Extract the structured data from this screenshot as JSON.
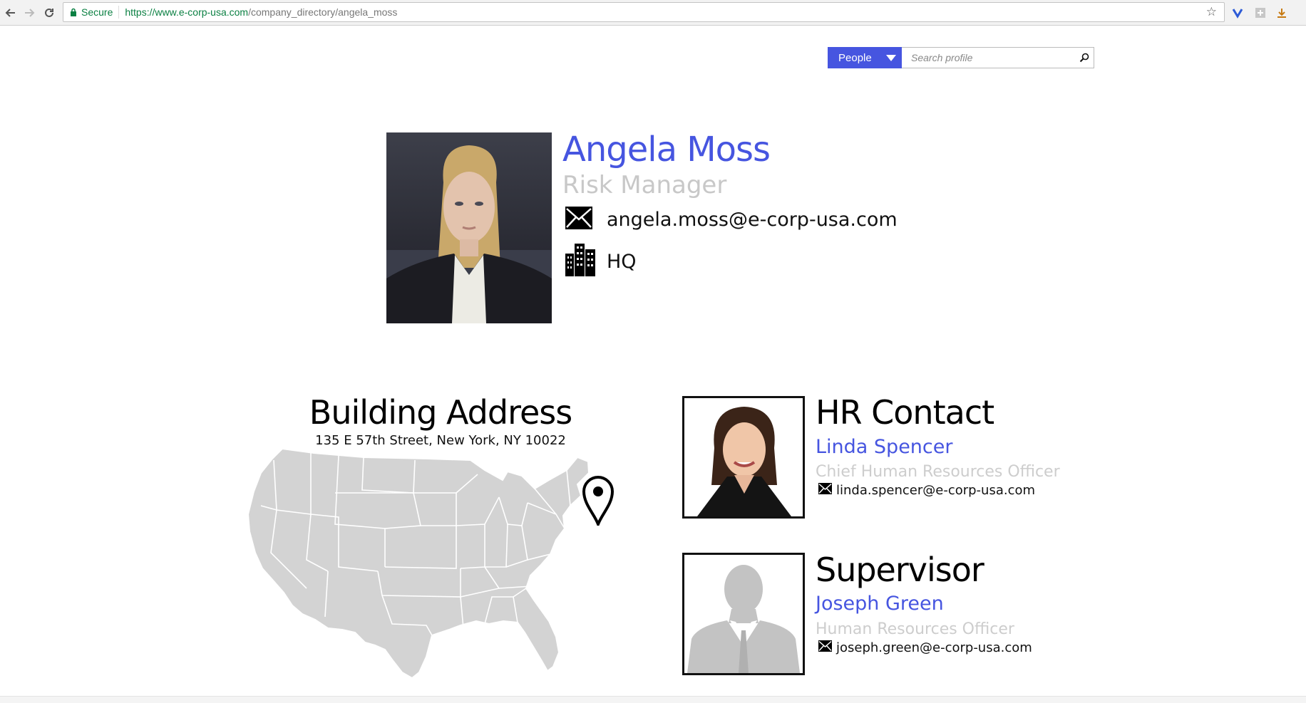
{
  "browser": {
    "secure_label": "Secure",
    "url_host": "https://www.e-corp-usa.com",
    "url_path": "/company_directory/angela_moss",
    "icons": [
      "back-icon",
      "forward-icon",
      "reload-icon",
      "lock-icon",
      "star-icon",
      "extension-icon",
      "download-icon"
    ]
  },
  "search": {
    "scope_label": "People",
    "placeholder": "Search profile"
  },
  "profile": {
    "name": "Angela Moss",
    "title": "Risk Manager",
    "email": "angela.moss@e-corp-usa.com",
    "location": "HQ"
  },
  "building": {
    "heading": "Building Address",
    "address": "135 E 57th Street, New York, NY 10022"
  },
  "hr_contact": {
    "heading": "HR Contact",
    "name": "Linda Spencer",
    "title": "Chief Human Resources Officer",
    "email": "linda.spencer@e-corp-usa.com"
  },
  "supervisor": {
    "heading": "Supervisor",
    "name": "Joseph Green",
    "title": "Human Resources Officer",
    "email": "joseph.green@e-corp-usa.com"
  },
  "colors": {
    "accent": "#4655e0",
    "muted": "#c8c8c8",
    "secure_green": "#0b8043",
    "map_fill": "#d3d3d3"
  }
}
